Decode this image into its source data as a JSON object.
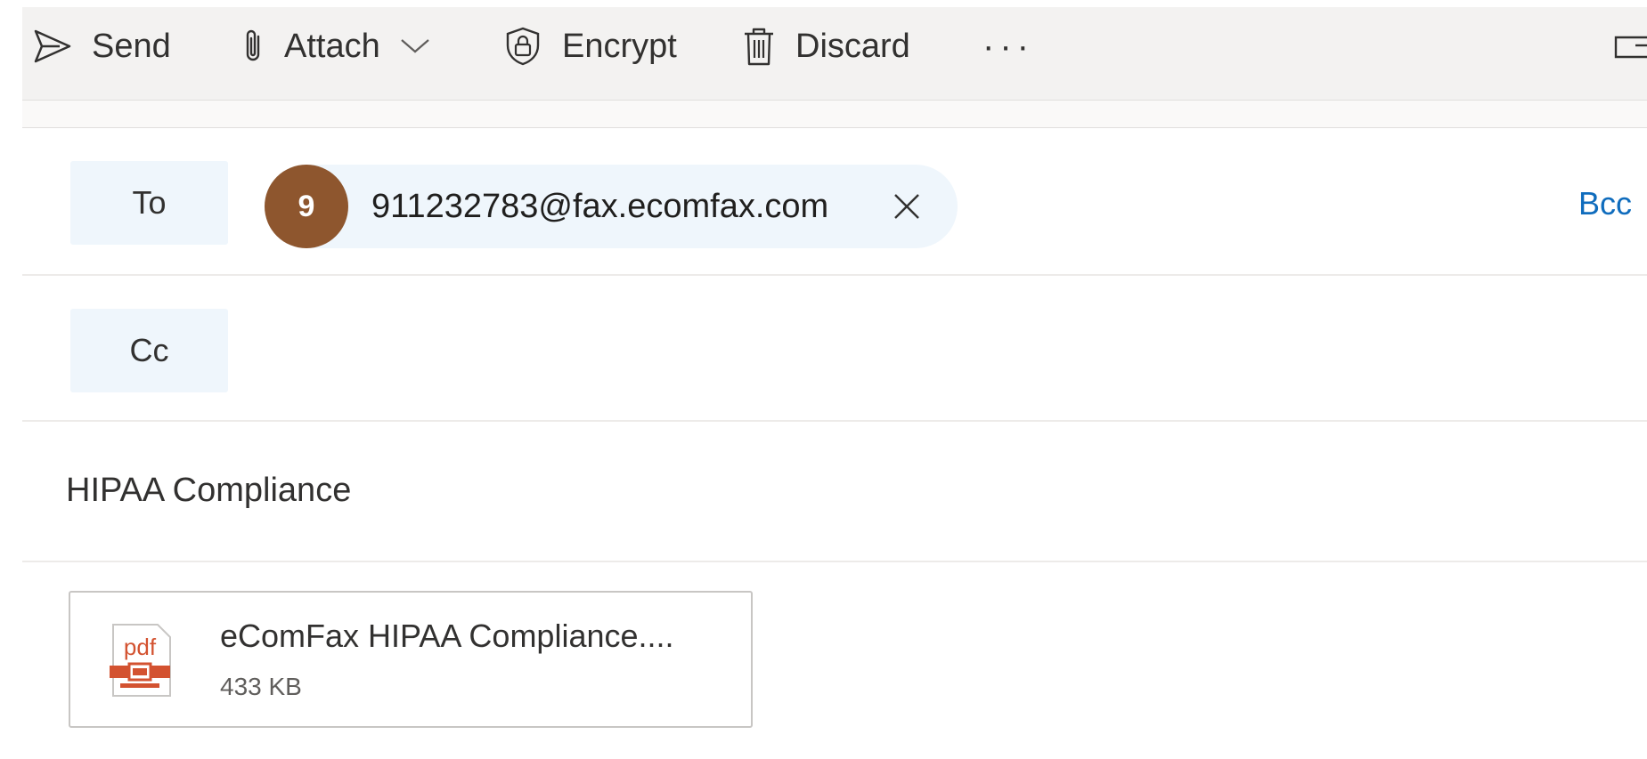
{
  "toolbar": {
    "send_label": "Send",
    "attach_label": "Attach",
    "encrypt_label": "Encrypt",
    "discard_label": "Discard",
    "more_label": "···"
  },
  "recipients": {
    "to_label": "To",
    "cc_label": "Cc",
    "bcc_label": "Bcc",
    "to_chips": [
      {
        "avatar_initial": "9",
        "email": "911232783@fax.ecomfax.com"
      }
    ]
  },
  "subject": "HIPAA Compliance",
  "attachment": {
    "name": "eComFax HIPAA Compliance....",
    "size": "433 KB",
    "icon_text": "pdf",
    "icon": "pdf-file-icon"
  },
  "colors": {
    "toolbar_bg": "#f3f2f1",
    "field_button_bg": "#eff6fc",
    "avatar_bg": "#8e562e",
    "link_blue": "#0f6cbd",
    "pdf_red": "#d35230"
  }
}
